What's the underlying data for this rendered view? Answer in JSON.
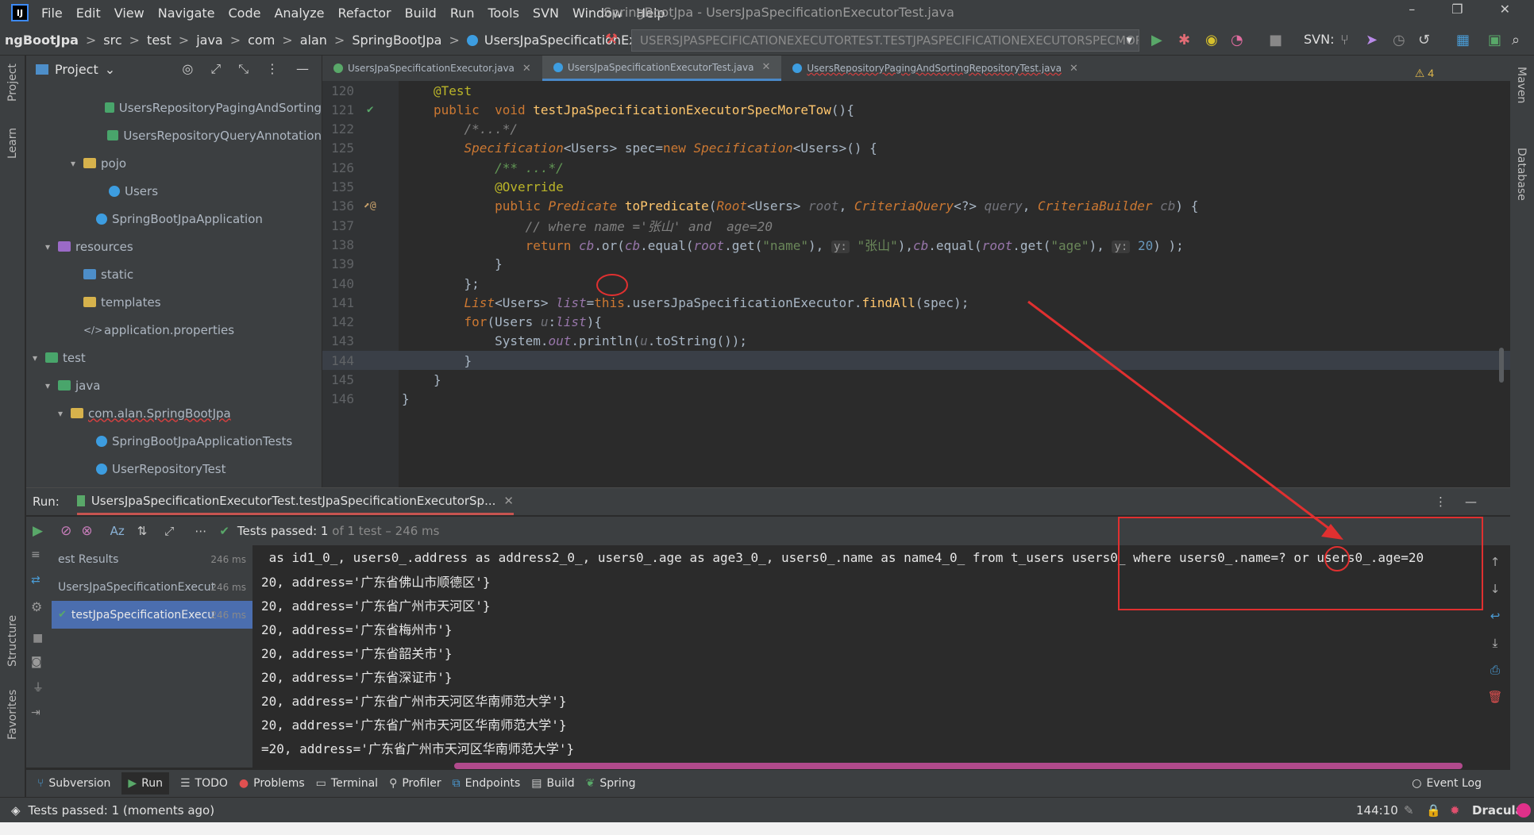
{
  "titlebar": {
    "menu": [
      "File",
      "Edit",
      "View",
      "Navigate",
      "Code",
      "Analyze",
      "Refactor",
      "Build",
      "Run",
      "Tools",
      "SVN",
      "Window",
      "Help"
    ],
    "title": "SpringBootJpa - UsersJpaSpecificationExecutorTest.java"
  },
  "navbar": {
    "crumbs": [
      "ngBootJpa",
      "src",
      "test",
      "java",
      "com",
      "alan",
      "SpringBootJpa",
      "UsersJpaSpecificationExecutorTest"
    ],
    "run_config": "USERSJPASPECIFICATIONEXECUTORTEST.TESTJPASPECIFICATIONEXECUTORSPECMORETOW",
    "svn_label": "SVN:"
  },
  "side": {
    "project": "Project",
    "learn": "Learn",
    "structure": "Structure",
    "favorites": "Favorites",
    "maven": "Maven",
    "database": "Database"
  },
  "project": {
    "title": "Project",
    "tree": [
      {
        "label": "UsersRepositoryPagingAndSorting",
        "icon": "class-test",
        "indent": 5
      },
      {
        "label": "UsersRepositoryQueryAnnotation",
        "icon": "class-test",
        "indent": 5
      },
      {
        "label": "pojo",
        "icon": "folder",
        "indent": 3,
        "arrow": "▾"
      },
      {
        "label": "Users",
        "icon": "class",
        "indent": 5
      },
      {
        "label": "SpringBootJpaApplication",
        "icon": "class",
        "indent": 4
      },
      {
        "label": "resources",
        "icon": "folder-res",
        "indent": 1,
        "arrow": "▾"
      },
      {
        "label": "static",
        "icon": "folder-blue",
        "indent": 3
      },
      {
        "label": "templates",
        "icon": "folder",
        "indent": 3
      },
      {
        "label": "application.properties",
        "icon": "props",
        "indent": 3
      },
      {
        "label": "test",
        "icon": "folder-green",
        "indent": 0,
        "arrow": "▾"
      },
      {
        "label": "java",
        "icon": "folder-green",
        "indent": 1,
        "arrow": "▾"
      },
      {
        "label": "com.alan.SpringBootJpa",
        "icon": "folder",
        "indent": 2,
        "arrow": "▾",
        "red": true
      },
      {
        "label": "SpringBootJpaApplicationTests",
        "icon": "class",
        "indent": 4
      },
      {
        "label": "UserRepositoryTest",
        "icon": "class",
        "indent": 4
      }
    ]
  },
  "editor": {
    "tabs": [
      {
        "label": "UsersJpaSpecificationExecutor.java",
        "active": false
      },
      {
        "label": "UsersJpaSpecificationExecutorTest.java",
        "active": true
      },
      {
        "label": "UsersRepositoryPagingAndSortingRepositoryTest.java",
        "active": false
      }
    ],
    "warnings": "4",
    "line_numbers": [
      "120",
      "121",
      "122",
      "125",
      "126",
      "135",
      "136",
      "137",
      "138",
      "139",
      "140",
      "141",
      "142",
      "143",
      "144",
      "145",
      "146"
    ],
    "current_line": "144"
  },
  "run": {
    "label": "Run:",
    "tab": "UsersJpaSpecificationExecutorTest.testJpaSpecificationExecutorSp...",
    "passed_main": "Tests passed: 1",
    "passed_sub": "of 1 test – 246 ms",
    "tree": [
      {
        "label": "est Results",
        "ms": "246 ms"
      },
      {
        "label": "UsersJpaSpecificationExecut",
        "ms": "246 ms"
      },
      {
        "label": "testJpaSpecificationExecu",
        "ms": "246 ms"
      }
    ],
    "console": [
      " as id1_0_, users0_.address as address2_0_, users0_.age as age3_0_, users0_.name as name4_0_ from t_users users0_ where users0_.name=? or users0_.age=20",
      "20, address='广东省佛山市顺德区'}",
      "20, address='广东省广州市天河区'}",
      "20, address='广东省梅州市'}",
      "20, address='广东省韶关市'}",
      "20, address='广东省深证市'}",
      "20, address='广东省广州市天河区华南师范大学'}",
      "20, address='广东省广州市天河区华南师范大学'}",
      "=20, address='广东省广州市天河区华南师范大学'}"
    ]
  },
  "toolbar": {
    "items": [
      "Subversion",
      "Run",
      "TODO",
      "Problems",
      "Terminal",
      "Profiler",
      "Endpoints",
      "Build",
      "Spring"
    ],
    "event_log": "Event Log"
  },
  "status": {
    "message": "Tests passed: 1 (moments ago)",
    "position": "144:10",
    "theme": "Dracula"
  },
  "colors": {
    "accent": "#4a88c7",
    "annotation": "#e03030",
    "pass": "#59a869"
  }
}
